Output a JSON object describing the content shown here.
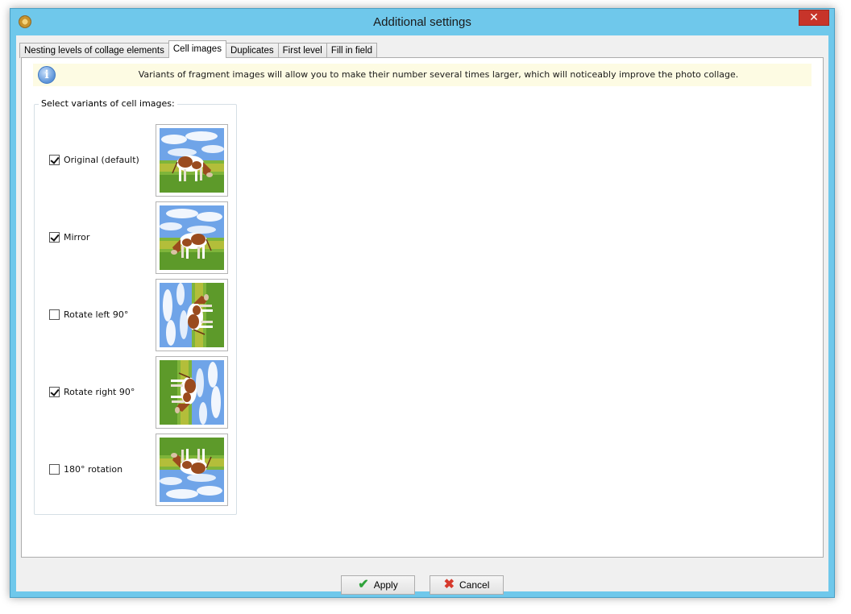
{
  "window": {
    "title": "Additional settings",
    "close_glyph": "✕"
  },
  "tabs": [
    {
      "label": "Nesting levels of collage elements",
      "active": false
    },
    {
      "label": "Cell images",
      "active": true
    },
    {
      "label": "Duplicates",
      "active": false
    },
    {
      "label": "First level",
      "active": false
    },
    {
      "label": "Fill in field",
      "active": false
    }
  ],
  "info": {
    "icon": "info-icon",
    "icon_glyph": "i",
    "text": "Variants of fragment images will allow you to make their number several times larger, which will noticeably improve the photo collage."
  },
  "variants_group": {
    "title": "Select variants of cell images:",
    "items": [
      {
        "label": "Original (default)",
        "checked": true,
        "transform": "original"
      },
      {
        "label": "Mirror",
        "checked": true,
        "transform": "mirror"
      },
      {
        "label": "Rotate left 90°",
        "checked": false,
        "transform": "rotate-left"
      },
      {
        "label": "Rotate right 90°",
        "checked": true,
        "transform": "rotate-right"
      },
      {
        "label": "180° rotation",
        "checked": false,
        "transform": "rotate-180"
      }
    ]
  },
  "buttons": {
    "apply_label": "Apply",
    "apply_icon": "checkmark-icon",
    "cancel_label": "Cancel",
    "cancel_icon": "cross-icon"
  }
}
